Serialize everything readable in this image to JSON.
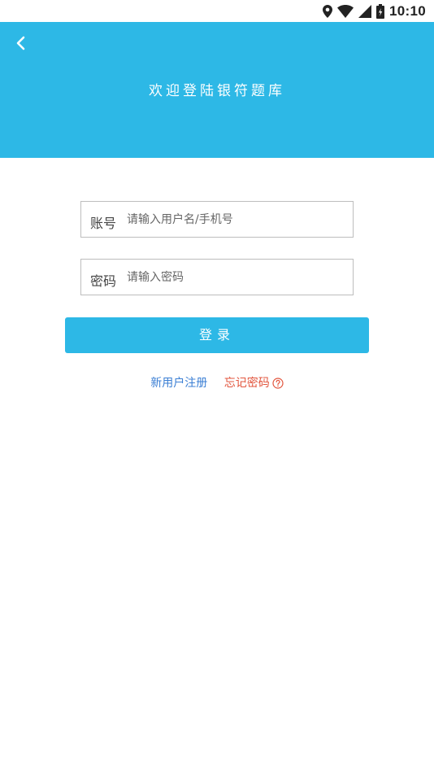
{
  "status_bar": {
    "time": "10:10",
    "icons": [
      "location-icon",
      "wifi-icon",
      "signal-icon",
      "battery-icon"
    ]
  },
  "header": {
    "title": "欢迎登陆银符题库",
    "background_color": "#2db8e6",
    "back_icon": "chevron-left-icon"
  },
  "form": {
    "account": {
      "label": "账号",
      "placeholder": "请输入用户名/手机号",
      "value": ""
    },
    "password": {
      "label": "密码",
      "placeholder": "请输入密码",
      "value": ""
    },
    "login_button": "登录"
  },
  "links": {
    "register": "新用户注册",
    "forgot_password": "忘记密码",
    "register_color": "#3b7fd4",
    "forgot_color": "#e2553d",
    "help_icon": "question-circle-icon"
  }
}
